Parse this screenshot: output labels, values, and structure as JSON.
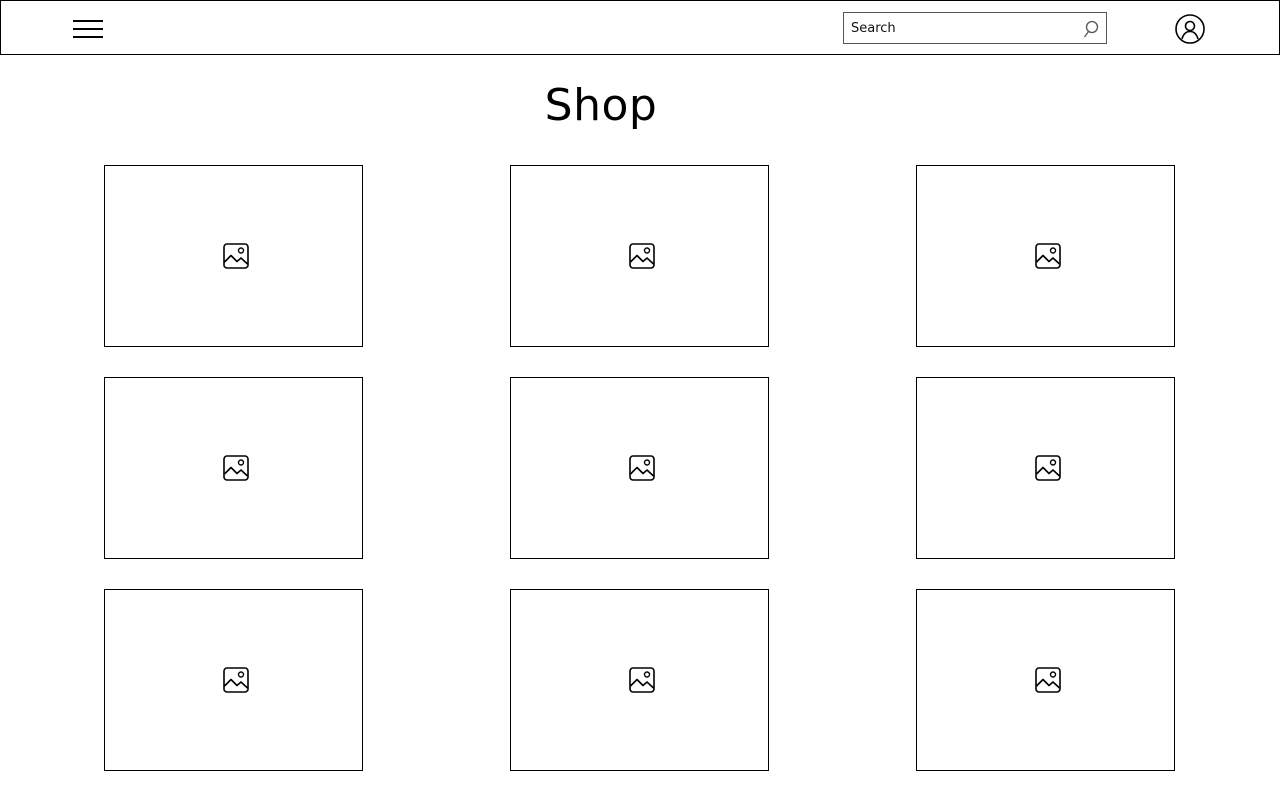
{
  "header": {
    "menu_icon": "hamburger-menu-icon",
    "search": {
      "placeholder": "Search",
      "value": "",
      "icon": "search-icon"
    },
    "account_icon": "user-account-icon"
  },
  "page": {
    "title": "Shop"
  },
  "products": [
    {
      "icon": "image-placeholder-icon"
    },
    {
      "icon": "image-placeholder-icon"
    },
    {
      "icon": "image-placeholder-icon"
    },
    {
      "icon": "image-placeholder-icon"
    },
    {
      "icon": "image-placeholder-icon"
    },
    {
      "icon": "image-placeholder-icon"
    },
    {
      "icon": "image-placeholder-icon"
    },
    {
      "icon": "image-placeholder-icon"
    },
    {
      "icon": "image-placeholder-icon"
    }
  ]
}
